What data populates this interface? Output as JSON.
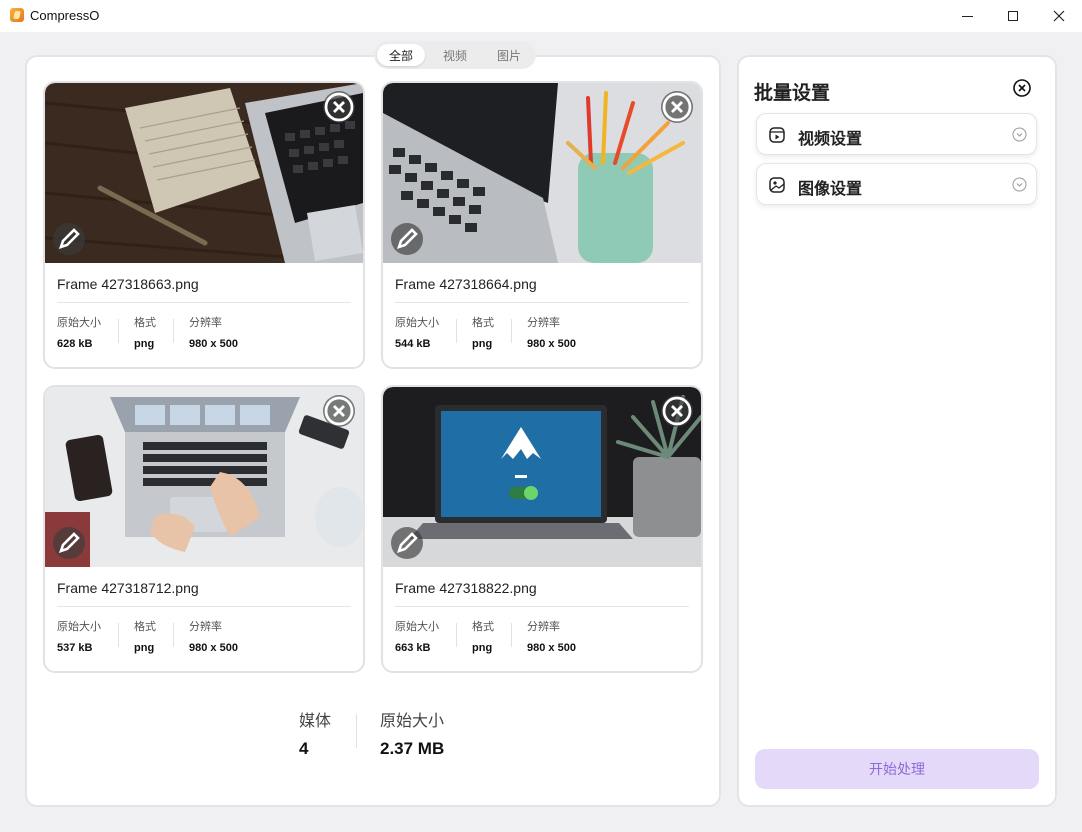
{
  "window": {
    "title": "CompressO"
  },
  "tabs": [
    {
      "label": "全部",
      "active": true
    },
    {
      "label": "视频",
      "active": false
    },
    {
      "label": "图片",
      "active": false
    }
  ],
  "files": [
    {
      "name": "Frame 427318663.png",
      "size": "628 kB",
      "format": "png",
      "resolution": "980 x 500"
    },
    {
      "name": "Frame 427318664.png",
      "size": "544 kB",
      "format": "png",
      "resolution": "980 x 500"
    },
    {
      "name": "Frame 427318712.png",
      "size": "537 kB",
      "format": "png",
      "resolution": "980 x 500"
    },
    {
      "name": "Frame 427318822.png",
      "size": "663 kB",
      "format": "png",
      "resolution": "980 x 500"
    }
  ],
  "meta_labels": {
    "size": "原始大小",
    "format": "格式",
    "resolution": "分辨率"
  },
  "summary": {
    "media_label": "媒体",
    "media_count": "4",
    "size_label": "原始大小",
    "size_value": "2.37 MB"
  },
  "settings": {
    "title": "批量设置",
    "video_label": "视频设置",
    "image_label": "图像设置",
    "start_label": "开始处理"
  },
  "thumb_icons": [
    "close-icon",
    "pencil-icon"
  ],
  "accent_color": "#e4d9f9"
}
